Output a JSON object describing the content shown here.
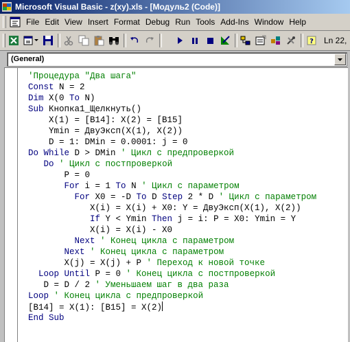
{
  "window": {
    "title": "Microsoft Visual Basic - z(xy).xls - [Модуль2 (Code)]"
  },
  "menubar": {
    "items": [
      "File",
      "Edit",
      "View",
      "Insert",
      "Format",
      "Debug",
      "Run",
      "Tools",
      "Add-Ins",
      "Window",
      "Help"
    ]
  },
  "toolbar": {
    "buttons": [
      "view-excel-icon",
      "insert-module-icon",
      "save-icon",
      "cut-icon",
      "copy-icon",
      "paste-icon",
      "find-icon",
      "undo-icon",
      "redo-icon",
      "run-icon",
      "break-icon",
      "reset-icon",
      "design-mode-icon",
      "project-explorer-icon",
      "properties-icon",
      "object-browser-icon",
      "toolbox-icon",
      "help-icon"
    ],
    "status": "Ln 22,"
  },
  "object_combo": {
    "value": "(General)"
  },
  "code": {
    "lines": [
      [
        {
          "t": "'Процедура \"Два шага\"",
          "c": "cm"
        }
      ],
      [
        {
          "t": "Const",
          "c": "kw"
        },
        {
          "t": " N = 2",
          "c": ""
        }
      ],
      [
        {
          "t": "Dim",
          "c": "kw"
        },
        {
          "t": " X(0 ",
          "c": ""
        },
        {
          "t": "To",
          "c": "kw"
        },
        {
          "t": " N)",
          "c": ""
        }
      ],
      [
        {
          "t": "Sub",
          "c": "kw"
        },
        {
          "t": " Кнопка1_Щелкнуть()",
          "c": ""
        }
      ],
      [
        {
          "t": "    X(1) = [B14]: X(2) = [B15]",
          "c": ""
        }
      ],
      [
        {
          "t": "    Ymin = ДвуЭксп(X(1), X(2))",
          "c": ""
        }
      ],
      [
        {
          "t": "    D = 1: DMin = 0.0001: j = 0",
          "c": ""
        }
      ],
      [
        {
          "t": "Do While",
          "c": "kw"
        },
        {
          "t": " D > DMin ",
          "c": ""
        },
        {
          "t": "' Цикл с предпроверкой",
          "c": "cm"
        }
      ],
      [
        {
          "t": "   ",
          "c": ""
        },
        {
          "t": "Do",
          "c": "kw"
        },
        {
          "t": " ",
          "c": ""
        },
        {
          "t": "' Цикл с постпроверкой",
          "c": "cm"
        }
      ],
      [
        {
          "t": "       P = 0",
          "c": ""
        }
      ],
      [
        {
          "t": "       ",
          "c": ""
        },
        {
          "t": "For",
          "c": "kw"
        },
        {
          "t": " i = 1 ",
          "c": ""
        },
        {
          "t": "To",
          "c": "kw"
        },
        {
          "t": " N ",
          "c": ""
        },
        {
          "t": "' Цикл с параметром",
          "c": "cm"
        }
      ],
      [
        {
          "t": "         ",
          "c": ""
        },
        {
          "t": "For",
          "c": "kw"
        },
        {
          "t": " X0 = -D ",
          "c": ""
        },
        {
          "t": "To",
          "c": "kw"
        },
        {
          "t": " D ",
          "c": ""
        },
        {
          "t": "Step",
          "c": "kw"
        },
        {
          "t": " 2 * D ",
          "c": ""
        },
        {
          "t": "' Цикл с параметром",
          "c": "cm"
        }
      ],
      [
        {
          "t": "            X(i) = X(i) + X0: Y = ДвуЭксп(X(1), X(2))",
          "c": ""
        }
      ],
      [
        {
          "t": "            ",
          "c": ""
        },
        {
          "t": "If",
          "c": "kw"
        },
        {
          "t": " Y < Ymin ",
          "c": ""
        },
        {
          "t": "Then",
          "c": "kw"
        },
        {
          "t": " j = i: P = X0: Ymin = Y",
          "c": ""
        }
      ],
      [
        {
          "t": "            X(i) = X(i) - X0",
          "c": ""
        }
      ],
      [
        {
          "t": "         ",
          "c": ""
        },
        {
          "t": "Next",
          "c": "kw"
        },
        {
          "t": " ",
          "c": ""
        },
        {
          "t": "' Конец цикла с параметром",
          "c": "cm"
        }
      ],
      [
        {
          "t": "       ",
          "c": ""
        },
        {
          "t": "Next",
          "c": "kw"
        },
        {
          "t": " ",
          "c": ""
        },
        {
          "t": "' Конец цикла с параметром",
          "c": "cm"
        }
      ],
      [
        {
          "t": "       X(j) = X(j) + P ",
          "c": ""
        },
        {
          "t": "' Переход к новой точке",
          "c": "cm"
        }
      ],
      [
        {
          "t": "  ",
          "c": ""
        },
        {
          "t": "Loop Until",
          "c": "kw"
        },
        {
          "t": " P = 0 ",
          "c": ""
        },
        {
          "t": "' Конец цикла с постпроверкой",
          "c": "cm"
        }
      ],
      [
        {
          "t": "   D = D / 2 ",
          "c": ""
        },
        {
          "t": "' Уменьшаем шаг в два раза",
          "c": "cm"
        }
      ],
      [
        {
          "t": "Loop",
          "c": "kw"
        },
        {
          "t": " ",
          "c": ""
        },
        {
          "t": "' Конец цикла с предпроверкой",
          "c": "cm"
        }
      ],
      [
        {
          "t": "[B14] = X(1): [B15] = X(2)",
          "c": ""
        }
      ],
      [
        {
          "t": "End Sub",
          "c": "kw"
        }
      ]
    ],
    "caret_line": 21
  },
  "colors": {
    "keyword": "#00007f",
    "comment": "#007f00",
    "title_gradient_start": "#0a246a",
    "title_gradient_end": "#a6caf0"
  }
}
